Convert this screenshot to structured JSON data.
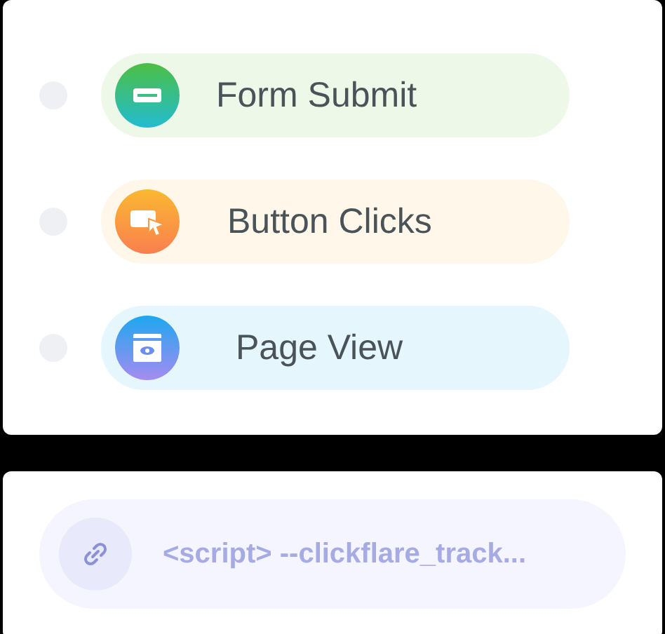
{
  "events": [
    {
      "kind": "form",
      "label": "Form Submit"
    },
    {
      "kind": "click",
      "label": "Button Clicks"
    },
    {
      "kind": "view",
      "label": "Page View"
    }
  ],
  "snippet": {
    "text": "<script> --clickflare_track..."
  }
}
